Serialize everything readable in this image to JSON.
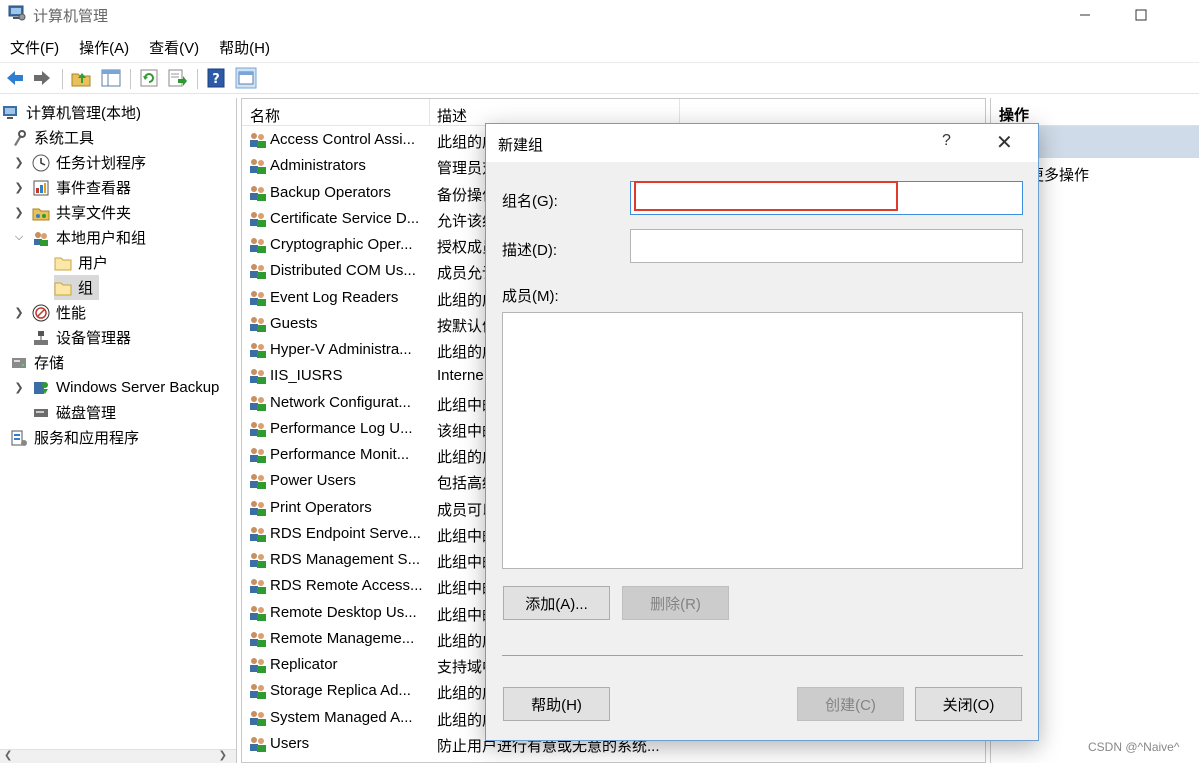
{
  "window": {
    "title": "计算机管理"
  },
  "menu": [
    "文件(F)",
    "操作(A)",
    "查看(V)",
    "帮助(H)"
  ],
  "toolbar": [
    "back-icon",
    "forward-icon",
    "up-folder-icon",
    "show-hide-tree-icon",
    "refresh-icon",
    "export-list-icon",
    "help-icon",
    "properties-icon"
  ],
  "tree": {
    "root": "计算机管理(本地)",
    "system_tools": "系统工具",
    "task_scheduler": "任务计划程序",
    "event_viewer": "事件查看器",
    "shared_folders": "共享文件夹",
    "local_users_groups": "本地用户和组",
    "users": "用户",
    "groups": "组",
    "performance": "性能",
    "device_manager": "设备管理器",
    "storage": "存储",
    "windows_server_backup": "Windows Server Backup",
    "disk_management": "磁盘管理",
    "services_apps": "服务和应用程序"
  },
  "list": {
    "columns": [
      "名称",
      "描述"
    ],
    "rows": [
      {
        "name": "Access Control Assi...",
        "desc": "此组的成"
      },
      {
        "name": "Administrators",
        "desc": "管理员对"
      },
      {
        "name": "Backup Operators",
        "desc": "备份操作"
      },
      {
        "name": "Certificate Service D...",
        "desc": "允许该组"
      },
      {
        "name": "Cryptographic Oper...",
        "desc": "授权成员"
      },
      {
        "name": "Distributed COM Us...",
        "desc": "成员允许"
      },
      {
        "name": "Event Log Readers",
        "desc": "此组的成"
      },
      {
        "name": "Guests",
        "desc": "按默认值"
      },
      {
        "name": "Hyper-V Administra...",
        "desc": "此组的成"
      },
      {
        "name": "IIS_IUSRS",
        "desc": "Interne"
      },
      {
        "name": "Network Configurat...",
        "desc": "此组中的"
      },
      {
        "name": "Performance Log U...",
        "desc": "该组中的"
      },
      {
        "name": "Performance Monit...",
        "desc": "此组的成"
      },
      {
        "name": "Power Users",
        "desc": "包括高级"
      },
      {
        "name": "Print Operators",
        "desc": "成员可以"
      },
      {
        "name": "RDS Endpoint Serve...",
        "desc": "此组中的"
      },
      {
        "name": "RDS Management S...",
        "desc": "此组中的"
      },
      {
        "name": "RDS Remote Access...",
        "desc": "此组中的"
      },
      {
        "name": "Remote Desktop Us...",
        "desc": "此组中的"
      },
      {
        "name": "Remote Manageme...",
        "desc": "此组的成"
      },
      {
        "name": "Replicator",
        "desc": "支持域中"
      },
      {
        "name": "Storage Replica Ad...",
        "desc": "此组的成"
      },
      {
        "name": "System Managed A...",
        "desc": "此组的成"
      },
      {
        "name": "Users",
        "desc": "防止用户进行有意或无意的系统..."
      }
    ]
  },
  "actions": {
    "header": "操作",
    "more": "更多操作"
  },
  "dialog": {
    "title": "新建组",
    "help_glyph": "?",
    "group_name_label": "组名(G):",
    "group_name_value": "",
    "description_label": "描述(D):",
    "description_value": "",
    "members_label": "成员(M):",
    "add_button": "添加(A)...",
    "remove_button": "删除(R)",
    "help_button": "帮助(H)",
    "create_button": "创建(C)",
    "close_button": "关闭(O)"
  },
  "watermark": "CSDN @^Naive^",
  "colors": {
    "highlight_box": "#e03a2a",
    "focus_border": "#3d8ee0",
    "action_band": "#cfdbe8"
  }
}
